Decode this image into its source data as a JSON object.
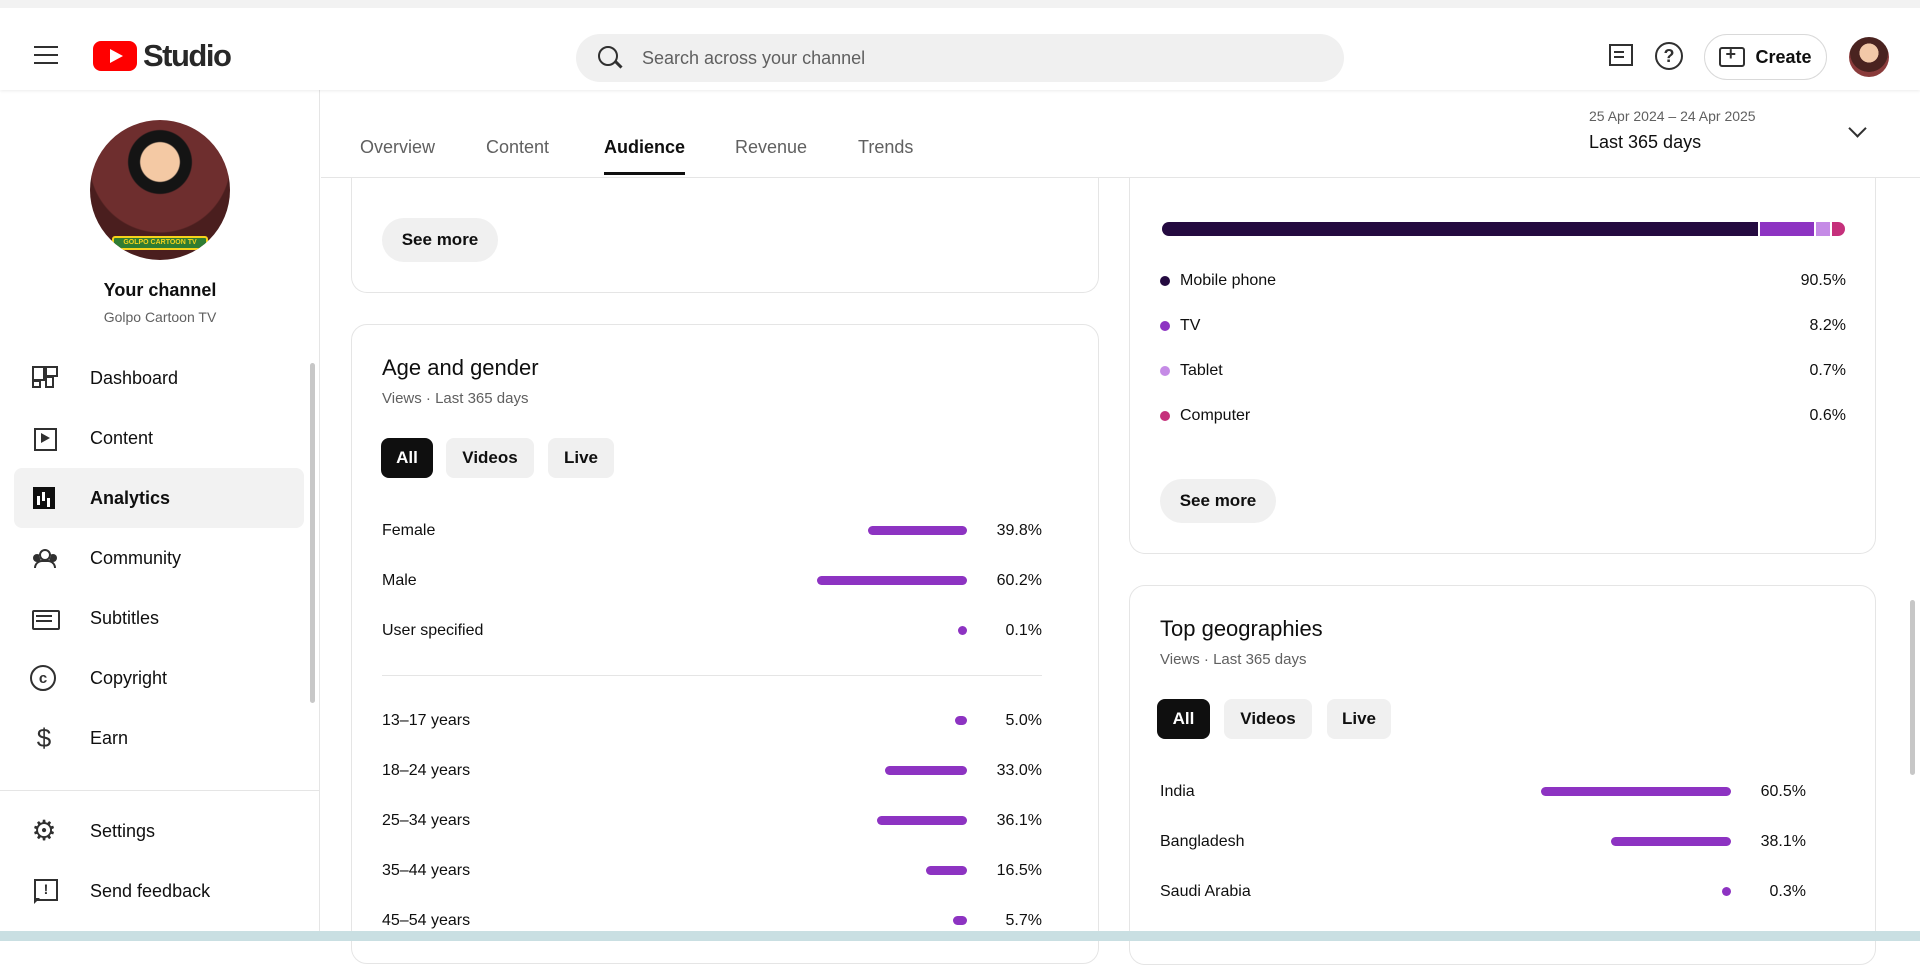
{
  "header": {
    "logo_text": "Studio",
    "search_placeholder": "Search across your channel",
    "create_label": "Create"
  },
  "sidebar": {
    "channel_title": "Your channel",
    "channel_name": "Golpo Cartoon TV",
    "avatar_banner": "GOLPO CARTOON TV",
    "items": [
      {
        "label": "Dashboard",
        "icon": "dashboard-icon"
      },
      {
        "label": "Content",
        "icon": "content-icon"
      },
      {
        "label": "Analytics",
        "icon": "analytics-icon",
        "active": true
      },
      {
        "label": "Community",
        "icon": "community-icon"
      },
      {
        "label": "Subtitles",
        "icon": "subtitles-icon"
      },
      {
        "label": "Copyright",
        "icon": "copyright-icon"
      },
      {
        "label": "Earn",
        "icon": "earn-icon"
      }
    ],
    "bottom_items": [
      {
        "label": "Settings",
        "icon": "settings-icon"
      },
      {
        "label": "Send feedback",
        "icon": "feedback-icon"
      }
    ]
  },
  "tabs": [
    "Overview",
    "Content",
    "Audience",
    "Revenue",
    "Trends"
  ],
  "active_tab": "Audience",
  "date_range": {
    "dates": "25 Apr 2024 – 24 Apr 2025",
    "label": "Last 365 days"
  },
  "see_more_label": "See more",
  "age_gender": {
    "title": "Age and gender",
    "subtitle": "Views · Last 365 days",
    "chips": [
      "All",
      "Videos",
      "Live"
    ],
    "gender": [
      {
        "label": "Female",
        "value": 39.8,
        "pct": "39.8%"
      },
      {
        "label": "Male",
        "value": 60.2,
        "pct": "60.2%"
      },
      {
        "label": "User specified",
        "value": 0.1,
        "pct": "0.1%"
      }
    ],
    "age": [
      {
        "label": "13–17 years",
        "value": 5.0,
        "pct": "5.0%"
      },
      {
        "label": "18–24 years",
        "value": 33.0,
        "pct": "33.0%"
      },
      {
        "label": "25–34 years",
        "value": 36.1,
        "pct": "36.1%"
      },
      {
        "label": "35–44 years",
        "value": 16.5,
        "pct": "16.5%"
      },
      {
        "label": "45–54 years",
        "value": 5.7,
        "pct": "5.7%"
      }
    ]
  },
  "device_type": {
    "segments": [
      {
        "label": "Mobile phone",
        "value": 90.5,
        "pct": "90.5%",
        "color": "#240a40"
      },
      {
        "label": "TV",
        "value": 8.2,
        "pct": "8.2%",
        "color": "#8d33c2"
      },
      {
        "label": "Tablet",
        "value": 0.7,
        "pct": "0.7%",
        "color": "#c58be6"
      },
      {
        "label": "Computer",
        "value": 0.6,
        "pct": "0.6%",
        "color": "#c5307b"
      }
    ]
  },
  "geographies": {
    "title": "Top geographies",
    "subtitle": "Views · Last 365 days",
    "chips": [
      "All",
      "Videos",
      "Live"
    ],
    "rows": [
      {
        "label": "India",
        "value": 60.5,
        "pct": "60.5%"
      },
      {
        "label": "Bangladesh",
        "value": 38.1,
        "pct": "38.1%"
      },
      {
        "label": "Saudi Arabia",
        "value": 0.3,
        "pct": "0.3%"
      }
    ]
  },
  "colors": {
    "bar": "#8d33c2",
    "accent": "#ff0000"
  }
}
